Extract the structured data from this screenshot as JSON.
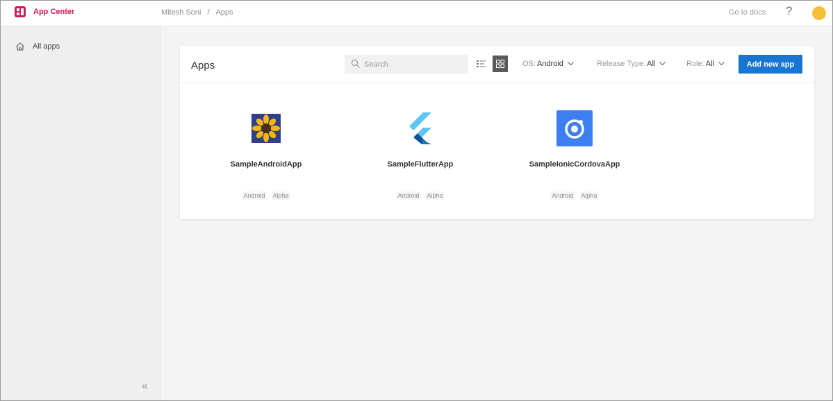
{
  "header": {
    "app_name": "App Center",
    "breadcrumb": [
      "Mitesh Soni",
      "Apps"
    ],
    "breadcrumb_separator": "/",
    "go_to_docs": "Go to docs",
    "help_label": "?",
    "brand_color": "#cc1b5c",
    "avatar_color": "#f5c037"
  },
  "sidebar": {
    "items": [
      {
        "label": "All apps",
        "icon": "home-icon"
      }
    ],
    "collapse_label": "«"
  },
  "apps_card": {
    "title": "Apps",
    "search": {
      "placeholder": "Search",
      "value": ""
    },
    "view_modes": [
      "list",
      "grid"
    ],
    "active_view": "grid",
    "filters": {
      "os": {
        "label": "OS:",
        "value": "Android"
      },
      "release_type": {
        "label": "Release Type:",
        "value": "All"
      },
      "role": {
        "label": "Role:",
        "value": "All"
      }
    },
    "add_button_label": "Add new app",
    "accent_color": "#1876d2",
    "apps": [
      {
        "name": "SampleAndroidApp",
        "icon": "sunflower-icon",
        "tags": [
          "Android",
          "Alpha"
        ]
      },
      {
        "name": "SampleFlutterApp",
        "icon": "flutter-icon",
        "tags": [
          "Android",
          "Alpha"
        ]
      },
      {
        "name": "SampleIonicCordovaApp",
        "icon": "ionic-icon",
        "tags": [
          "Android",
          "Alpha"
        ]
      }
    ]
  }
}
